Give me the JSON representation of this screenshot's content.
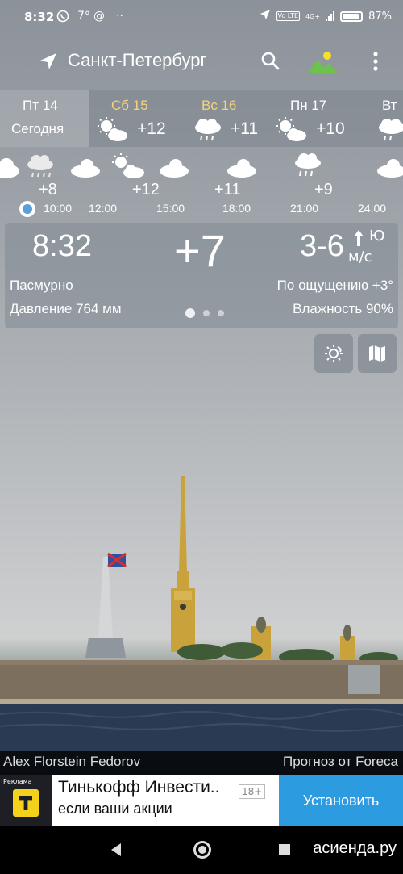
{
  "status_bar": {
    "time": "8:32",
    "temp": "7°",
    "at_sign": "@",
    "dots": "··",
    "network": "4G+",
    "volte": "Vo LTE",
    "battery": "87%"
  },
  "app_bar": {
    "city": "Санкт-Петербург"
  },
  "days": [
    {
      "name": "Пт 14",
      "sub": "Сегодня",
      "selected": true,
      "weekend": false
    },
    {
      "name": "Сб 15",
      "temp": "+12",
      "icon": "partly-cloudy-icon",
      "weekend": true
    },
    {
      "name": "Вс 16",
      "temp": "+11",
      "icon": "rain-cloud-icon",
      "weekend": true
    },
    {
      "name": "Пн 17",
      "temp": "+10",
      "icon": "partly-cloudy-icon",
      "weekend": false
    },
    {
      "name": "Вт",
      "icon": "rain-cloud-icon",
      "weekend": false
    }
  ],
  "hourly": {
    "temps": [
      "+8",
      "+12",
      "+11",
      "+9"
    ],
    "times": [
      "10:00",
      "12:00",
      "15:00",
      "18:00",
      "21:00",
      "24:00"
    ]
  },
  "current": {
    "time": "8:32",
    "temp": "+7",
    "wind": "3-6",
    "wind_dir": "Ю",
    "wind_unit": "м/с",
    "condition": "Пасмурно",
    "feels_like": "По ощущению +3°",
    "pressure": "Давление 764 мм",
    "humidity": "Влажность 90%"
  },
  "credits": {
    "author": "Alex Florstein Fedorov",
    "provider": "Прогноз от Foreca"
  },
  "ad": {
    "label": "Реклама",
    "title": "Тинькофф Инвести..",
    "age": "18+",
    "subtitle": "если ваши акции",
    "button": "Установить"
  },
  "watermark": "асиенда.ру",
  "colors": {
    "weekend": "#f6d27a",
    "ad_button": "#2d9be0",
    "current_dot": "#5aa0d8"
  }
}
